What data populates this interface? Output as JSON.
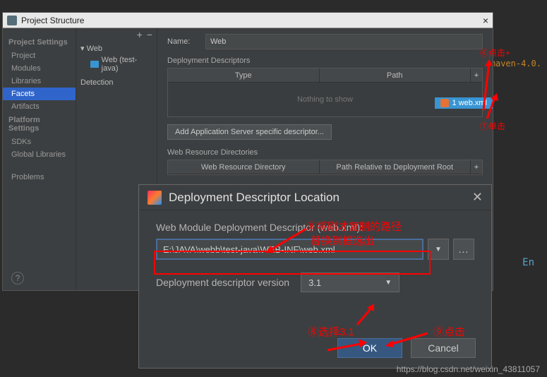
{
  "window": {
    "title": "Project Structure"
  },
  "sidebar": {
    "heading1": "Project Settings",
    "items1": [
      "Project",
      "Modules",
      "Libraries",
      "Facets",
      "Artifacts"
    ],
    "heading2": "Platform Settings",
    "items2": [
      "SDKs",
      "Global Libraries"
    ],
    "problems": "Problems"
  },
  "middle": {
    "root": "Web",
    "child": "Web (test-java)",
    "detection": "Detection"
  },
  "right": {
    "name_label": "Name:",
    "name_value": "Web",
    "dd_section": "Deployment Descriptors",
    "col_type": "Type",
    "col_path": "Path",
    "nothing": "Nothing to show",
    "add_server": "Add Application Server specific descriptor...",
    "wrd_section": "Web Resource Directories",
    "col_wrd": "Web Resource Directory",
    "col_root": "Path Relative to Deployment Root",
    "webxml_tag": "1  web.xml"
  },
  "dialog": {
    "title": "Deployment Descriptor Location",
    "label1": "Web Module Deployment Descriptor (web.xml):",
    "path": "E:\\JAVA\\webb\\test-java\\WEB-INF\\web.xml",
    "label2": "Deployment descriptor version",
    "version": "3.1",
    "ok": "OK",
    "cancel": "Cancel"
  },
  "annotations": {
    "a6": "⑥点击+",
    "a7": "⑦单击",
    "a8a": "⑧将刚才复制的路径",
    "a8b": "替换到框选出",
    "a8c": "⑧选择3.1",
    "a9": "⑨点击"
  },
  "bg": {
    "maven": "d/maven-4.0.",
    "en": "En"
  },
  "watermark": "https://blog.csdn.net/weixin_43811057"
}
